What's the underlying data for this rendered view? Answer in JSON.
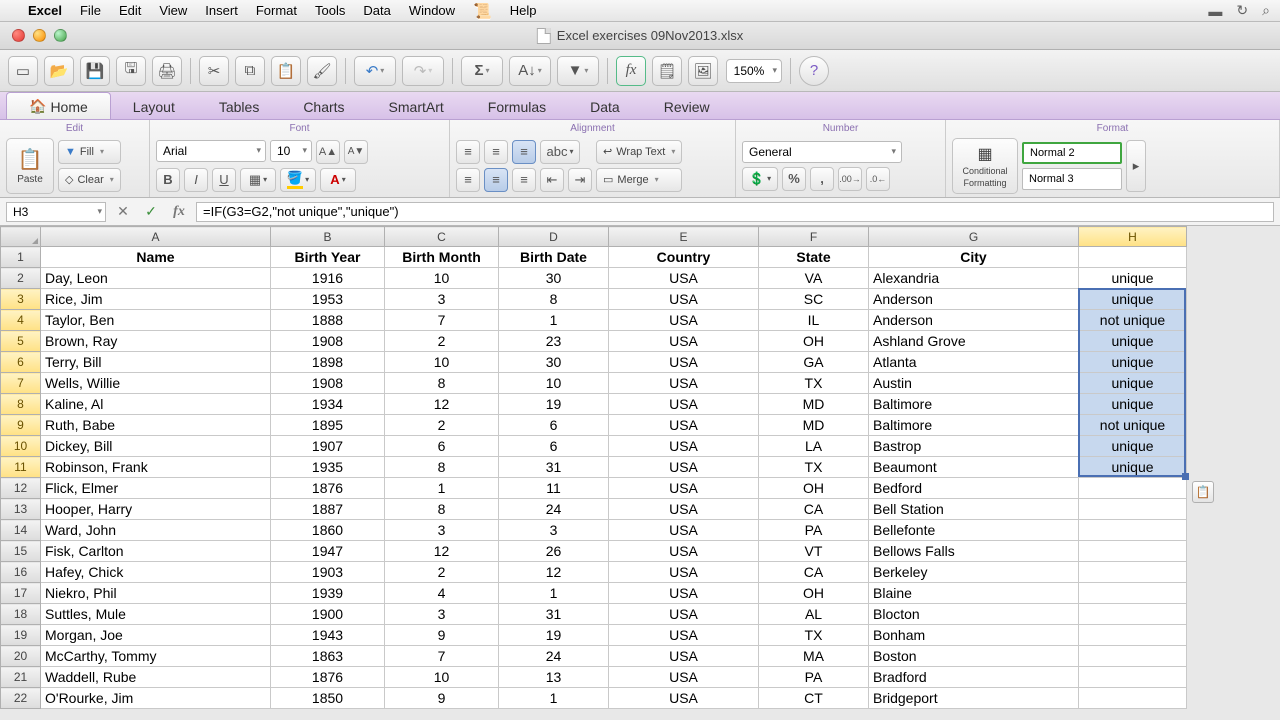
{
  "menubar": {
    "app": "Excel",
    "items": [
      "File",
      "Edit",
      "View",
      "Insert",
      "Format",
      "Tools",
      "Data",
      "Window",
      "Help"
    ]
  },
  "window": {
    "title": "Excel exercises 09Nov2013.xlsx"
  },
  "toolbar": {
    "zoom": "150%"
  },
  "ribbon": {
    "tabs": [
      "Home",
      "Layout",
      "Tables",
      "Charts",
      "SmartArt",
      "Formulas",
      "Data",
      "Review"
    ],
    "active": "Home",
    "groups": {
      "edit": {
        "label": "Edit",
        "paste": "Paste",
        "fill": "Fill",
        "clear": "Clear"
      },
      "font": {
        "label": "Font",
        "name": "Arial",
        "size": "10"
      },
      "alignment": {
        "label": "Alignment",
        "wrap": "Wrap Text",
        "merge": "Merge"
      },
      "number": {
        "label": "Number",
        "format": "General"
      },
      "format": {
        "label": "Format",
        "cond_fmt_l1": "Conditional",
        "cond_fmt_l2": "Formatting",
        "style1": "Normal 2",
        "style2": "Normal 3"
      }
    }
  },
  "formula_bar": {
    "cell": "H3",
    "formula": "=IF(G3=G2,\"not unique\",\"unique\")"
  },
  "columns": [
    "A",
    "B",
    "C",
    "D",
    "E",
    "F",
    "G",
    "H"
  ],
  "headers": {
    "A": "Name",
    "B": "Birth Year",
    "C": "Birth Month",
    "D": "Birth Date",
    "E": "Country",
    "F": "State",
    "G": "City",
    "H": ""
  },
  "rows": [
    {
      "n": 2,
      "A": "Day, Leon",
      "B": "1916",
      "C": "10",
      "D": "30",
      "E": "USA",
      "F": "VA",
      "G": "Alexandria",
      "H": "unique"
    },
    {
      "n": 3,
      "A": "Rice, Jim",
      "B": "1953",
      "C": "3",
      "D": "8",
      "E": "USA",
      "F": "SC",
      "G": "Anderson",
      "H": "unique"
    },
    {
      "n": 4,
      "A": "Taylor, Ben",
      "B": "1888",
      "C": "7",
      "D": "1",
      "E": "USA",
      "F": "IL",
      "G": "Anderson",
      "H": "not unique"
    },
    {
      "n": 5,
      "A": "Brown, Ray",
      "B": "1908",
      "C": "2",
      "D": "23",
      "E": "USA",
      "F": "OH",
      "G": "Ashland Grove",
      "H": "unique"
    },
    {
      "n": 6,
      "A": "Terry, Bill",
      "B": "1898",
      "C": "10",
      "D": "30",
      "E": "USA",
      "F": "GA",
      "G": "Atlanta",
      "H": "unique"
    },
    {
      "n": 7,
      "A": "Wells, Willie",
      "B": "1908",
      "C": "8",
      "D": "10",
      "E": "USA",
      "F": "TX",
      "G": "Austin",
      "H": "unique"
    },
    {
      "n": 8,
      "A": "Kaline, Al",
      "B": "1934",
      "C": "12",
      "D": "19",
      "E": "USA",
      "F": "MD",
      "G": "Baltimore",
      "H": "unique"
    },
    {
      "n": 9,
      "A": "Ruth, Babe",
      "B": "1895",
      "C": "2",
      "D": "6",
      "E": "USA",
      "F": "MD",
      "G": "Baltimore",
      "H": "not unique"
    },
    {
      "n": 10,
      "A": "Dickey, Bill",
      "B": "1907",
      "C": "6",
      "D": "6",
      "E": "USA",
      "F": "LA",
      "G": "Bastrop",
      "H": "unique"
    },
    {
      "n": 11,
      "A": "Robinson, Frank",
      "B": "1935",
      "C": "8",
      "D": "31",
      "E": "USA",
      "F": "TX",
      "G": "Beaumont",
      "H": "unique"
    },
    {
      "n": 12,
      "A": "Flick, Elmer",
      "B": "1876",
      "C": "1",
      "D": "11",
      "E": "USA",
      "F": "OH",
      "G": "Bedford",
      "H": ""
    },
    {
      "n": 13,
      "A": "Hooper, Harry",
      "B": "1887",
      "C": "8",
      "D": "24",
      "E": "USA",
      "F": "CA",
      "G": "Bell Station",
      "H": ""
    },
    {
      "n": 14,
      "A": "Ward, John",
      "B": "1860",
      "C": "3",
      "D": "3",
      "E": "USA",
      "F": "PA",
      "G": "Bellefonte",
      "H": ""
    },
    {
      "n": 15,
      "A": "Fisk, Carlton",
      "B": "1947",
      "C": "12",
      "D": "26",
      "E": "USA",
      "F": "VT",
      "G": "Bellows Falls",
      "H": ""
    },
    {
      "n": 16,
      "A": "Hafey, Chick",
      "B": "1903",
      "C": "2",
      "D": "12",
      "E": "USA",
      "F": "CA",
      "G": "Berkeley",
      "H": ""
    },
    {
      "n": 17,
      "A": "Niekro, Phil",
      "B": "1939",
      "C": "4",
      "D": "1",
      "E": "USA",
      "F": "OH",
      "G": "Blaine",
      "H": ""
    },
    {
      "n": 18,
      "A": "Suttles, Mule",
      "B": "1900",
      "C": "3",
      "D": "31",
      "E": "USA",
      "F": "AL",
      "G": "Blocton",
      "H": ""
    },
    {
      "n": 19,
      "A": "Morgan, Joe",
      "B": "1943",
      "C": "9",
      "D": "19",
      "E": "USA",
      "F": "TX",
      "G": "Bonham",
      "H": ""
    },
    {
      "n": 20,
      "A": "McCarthy, Tommy",
      "B": "1863",
      "C": "7",
      "D": "24",
      "E": "USA",
      "F": "MA",
      "G": "Boston",
      "H": ""
    },
    {
      "n": 21,
      "A": "Waddell, Rube",
      "B": "1876",
      "C": "10",
      "D": "13",
      "E": "USA",
      "F": "PA",
      "G": "Bradford",
      "H": ""
    },
    {
      "n": 22,
      "A": "O'Rourke, Jim",
      "B": "1850",
      "C": "9",
      "D": "1",
      "E": "USA",
      "F": "CT",
      "G": "Bridgeport",
      "H": ""
    }
  ],
  "selection": {
    "col": "H",
    "row_start": 3,
    "row_end": 11
  }
}
